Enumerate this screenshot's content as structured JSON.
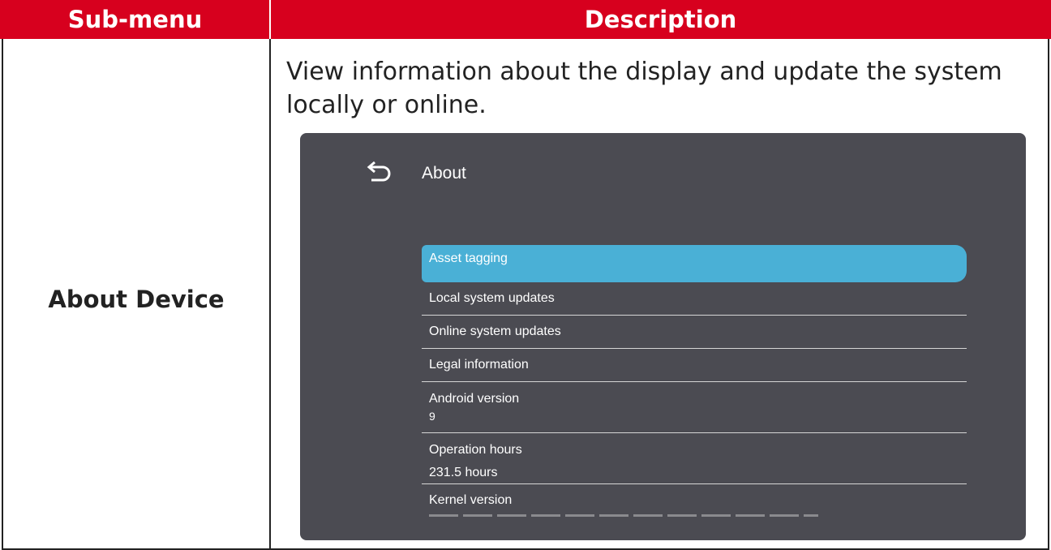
{
  "header": {
    "submenu_label": "Sub-menu",
    "description_label": "Description"
  },
  "row": {
    "submenu": "About Device",
    "description": "View information about the display and update the system locally or online."
  },
  "screen": {
    "back_icon": "back-arrow-icon",
    "title": "About",
    "items": [
      {
        "label": "Asset tagging"
      },
      {
        "label": "Local system updates"
      },
      {
        "label": "Online system updates"
      },
      {
        "label": "Legal information"
      },
      {
        "label": "Android version",
        "value": "9"
      },
      {
        "label": "Operation hours",
        "value": "231.5 hours"
      },
      {
        "label": "Kernel version"
      }
    ],
    "selected_index": 0
  },
  "colors": {
    "header_bg": "#d7001e",
    "screen_bg": "#4b4b52",
    "selected_item": "#4ab0d6"
  }
}
